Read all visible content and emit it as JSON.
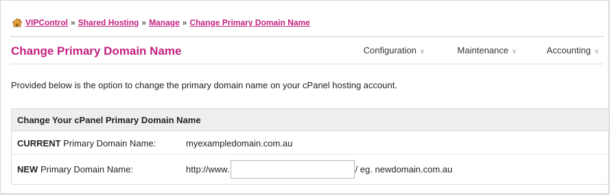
{
  "breadcrumb": {
    "icon": "home-icon",
    "items": [
      "VIPControl",
      "Shared Hosting",
      "Manage",
      "Change Primary Domain Name"
    ],
    "separator": "»"
  },
  "page": {
    "title": "Change Primary Domain Name",
    "intro": "Provided below is the option to change the primary domain name on your cPanel hosting account."
  },
  "nav": {
    "items": [
      "Configuration",
      "Maintenance",
      "Accounting"
    ],
    "chevron": "v"
  },
  "panel": {
    "heading": "Change Your cPanel Primary Domain Name",
    "current": {
      "label_strong": "CURRENT",
      "label_rest": " Primary Domain Name:",
      "value": "myexampledomain.com.au"
    },
    "new": {
      "label_strong": "NEW",
      "label_rest": " Primary Domain Name:",
      "prefix": "http://www.",
      "input_value": "",
      "suffix": "/ eg. newdomain.com.au"
    }
  },
  "colors": {
    "accent": "#c2207e",
    "panel_header_bg": "#eeeeee"
  }
}
